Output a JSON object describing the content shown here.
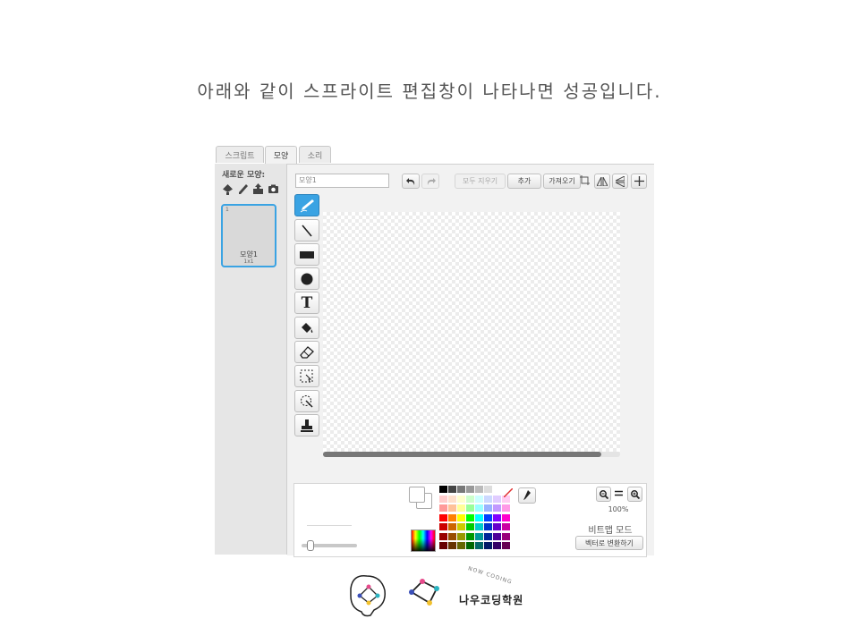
{
  "headline": "아래와 같이 스프라이트 편집창이 나타나면 성공입니다.",
  "tabs": [
    {
      "label": "스크립트"
    },
    {
      "label": "모양"
    },
    {
      "label": "소리"
    }
  ],
  "left_panel": {
    "new_costume_label": "새로운 모양:",
    "icons": [
      "paint-new-icon",
      "brush-icon",
      "upload-icon",
      "camera-icon"
    ],
    "costume": {
      "number": "1",
      "name": "모양1",
      "size": "1x1"
    }
  },
  "toolbar": {
    "costume_name_value": "모양1",
    "clear_label": "모두 지우기",
    "add_label": "추가",
    "import_label": "가져오기"
  },
  "tools": [
    "brush",
    "line",
    "rectangle",
    "ellipse",
    "text",
    "fill",
    "eraser",
    "select",
    "magic-select",
    "stamp"
  ],
  "bottom": {
    "zoom_level": "100%",
    "mode_label": "비트맵 모드",
    "convert_label": "벡터로 변환하기"
  },
  "palette": {
    "rows": [
      [
        "#000000",
        "#444444",
        "#777777",
        "#999999",
        "#bbbbbb",
        "#dddddd",
        "#ffffff"
      ],
      [
        "#ffcccc",
        "#ffe0cc",
        "#ffffcc",
        "#ccffcc",
        "#ccffff",
        "#ccd9ff",
        "#e0ccff",
        "#ffccf2"
      ],
      [
        "#ff9999",
        "#ffc299",
        "#ffff99",
        "#99ff99",
        "#99ffff",
        "#99b3ff",
        "#c299ff",
        "#ff99e6"
      ],
      [
        "#ff0000",
        "#ff8000",
        "#ffff00",
        "#00ff00",
        "#00ffff",
        "#0040ff",
        "#8000ff",
        "#ff00cc"
      ],
      [
        "#cc0000",
        "#cc6600",
        "#cccc00",
        "#00cc00",
        "#00cccc",
        "#0033cc",
        "#6600cc",
        "#cc00a3"
      ],
      [
        "#990000",
        "#994d00",
        "#999900",
        "#009900",
        "#009999",
        "#002699",
        "#4d0099",
        "#99007a"
      ],
      [
        "#660000",
        "#663300",
        "#666600",
        "#006600",
        "#006666",
        "#001a66",
        "#330066",
        "#660052"
      ]
    ]
  },
  "footer": {
    "arc_text": "NOW CODING",
    "name": "나우코딩학원"
  }
}
